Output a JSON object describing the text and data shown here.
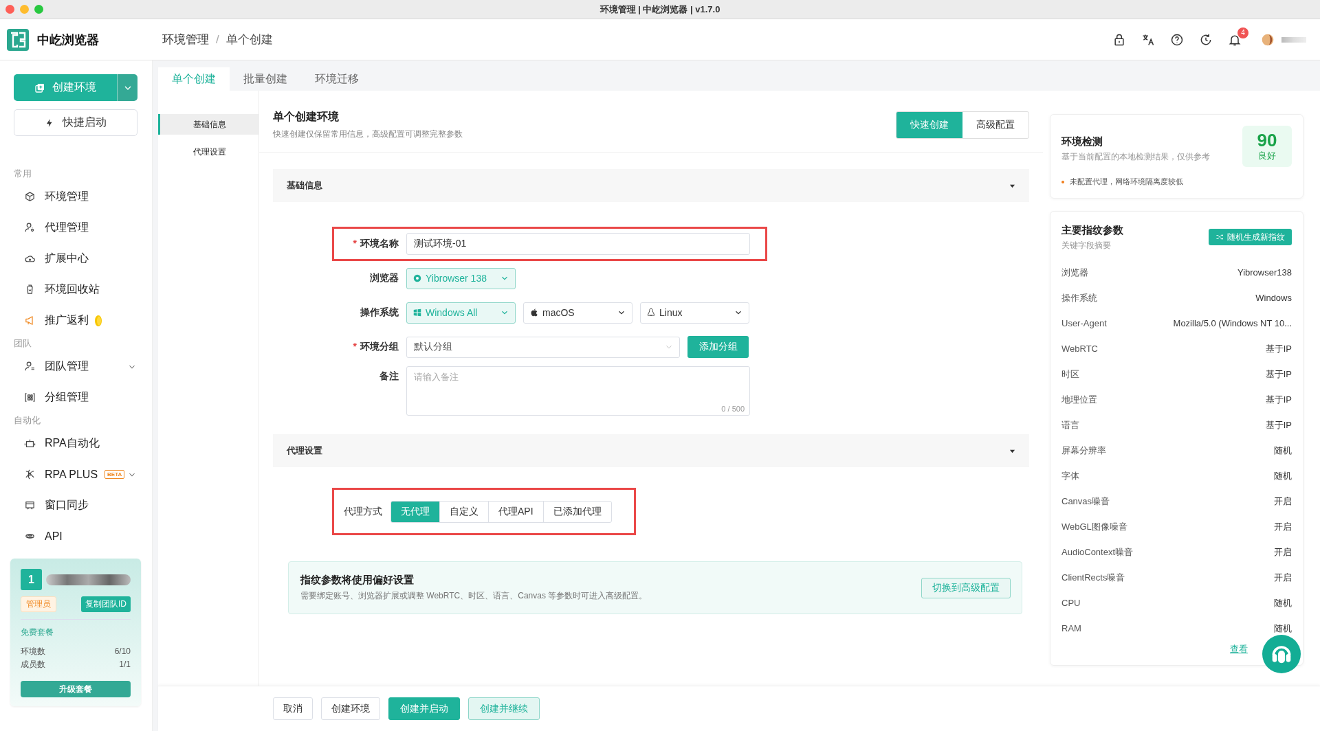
{
  "window": {
    "title": "环境管理 | 中屹浏览器 | v1.7.0"
  },
  "app": {
    "name": "中屹浏览器"
  },
  "breadcrumb": [
    "环境管理",
    "单个创建"
  ],
  "breadcrumb_separator": "/",
  "header": {
    "notification_count": "4"
  },
  "sidebar": {
    "create_button": "创建环境",
    "quick_start_button": "快捷启动",
    "sections": [
      {
        "title": "常用",
        "items": [
          {
            "label": "环境管理",
            "kind": "link"
          },
          {
            "label": "代理管理",
            "kind": "link"
          },
          {
            "label": "扩展中心",
            "kind": "link"
          },
          {
            "label": "环境回收站",
            "kind": "link"
          },
          {
            "label": "推广返利",
            "kind": "promo"
          }
        ]
      },
      {
        "title": "团队",
        "items": [
          {
            "label": "团队管理",
            "kind": "group",
            "expanded": false
          },
          {
            "label": "分组管理",
            "kind": "link"
          }
        ]
      },
      {
        "title": "自动化",
        "items": [
          {
            "label": "RPA自动化",
            "kind": "link"
          },
          {
            "label": "RPA PLUS",
            "kind": "group",
            "expanded": false,
            "badge": "BETA"
          },
          {
            "label": "窗口同步",
            "kind": "link"
          },
          {
            "label": "API",
            "kind": "link"
          }
        ]
      }
    ]
  },
  "team_card": {
    "number": "1",
    "role": "管理员",
    "copy_button": "复制团队ID",
    "plan": "免费套餐",
    "stats": [
      {
        "label": "环境数",
        "value": "6/10"
      },
      {
        "label": "成员数",
        "value": "1/1"
      }
    ],
    "upgrade_button": "升级套餐"
  },
  "tabs": [
    {
      "label": "单个创建",
      "selected": true
    },
    {
      "label": "批量创建",
      "selected": false
    },
    {
      "label": "环境迁移",
      "selected": false
    }
  ],
  "side_nav": [
    {
      "label": "基础信息",
      "selected": true
    },
    {
      "label": "代理设置",
      "selected": false
    }
  ],
  "page_header": {
    "title": "单个创建环境",
    "subtitle": "快速创建仅保留常用信息，高级配置可调整完整参数",
    "modes": [
      {
        "label": "快速创建",
        "selected": true
      },
      {
        "label": "高级配置",
        "selected": false
      }
    ]
  },
  "basic_info": {
    "title": "基础信息",
    "expanded": true,
    "name": {
      "label": "环境名称",
      "required_mark": "*",
      "highlighted": true,
      "value": "测试环境-01"
    },
    "browser": {
      "label": "浏览器",
      "options": [
        {
          "label": "Yibrowser 138",
          "selected": true
        }
      ]
    },
    "os": {
      "label": "操作系统",
      "options": [
        {
          "label": "Windows All",
          "selected": true
        },
        {
          "label": "macOS",
          "selected": false
        },
        {
          "label": "Linux",
          "selected": false
        }
      ]
    },
    "group": {
      "label": "环境分组",
      "required_mark": "*",
      "value": "默认分组",
      "button": "添加分组"
    },
    "notes": {
      "label": "备注",
      "placeholder": "请输入备注",
      "counter": "0 / 500"
    }
  },
  "proxy": {
    "title": "代理设置",
    "expanded": true,
    "label": "代理方式",
    "highlighted": true,
    "options": [
      {
        "label": "无代理",
        "selected": true
      },
      {
        "label": "自定义",
        "selected": false
      },
      {
        "label": "代理API",
        "selected": false
      },
      {
        "label": "已添加代理",
        "selected": false
      }
    ]
  },
  "notice": {
    "title": "指纹参数将使用偏好设置",
    "text": "需要绑定账号、浏览器扩展或调整 WebRTC、时区、语言、Canvas 等参数时可进入高级配置。",
    "button": "切换到高级配置"
  },
  "footer_buttons": [
    {
      "label": "取消",
      "kind": "default"
    },
    {
      "label": "创建环境",
      "kind": "default"
    },
    {
      "label": "创建并启动",
      "kind": "primary"
    },
    {
      "label": "创建并继续",
      "kind": "light"
    }
  ],
  "detection": {
    "title": "环境检测",
    "subtitle": "基于当前配置的本地检测结果，仅供参考",
    "score": "90",
    "grade": "良好",
    "warnings": [
      {
        "text": "未配置代理，网络环境隔离度较低",
        "color": "#f07d1a"
      }
    ]
  },
  "fingerprint": {
    "title": "主要指纹参数",
    "subtitle": "关键字段摘要",
    "button": "随机生成新指纹",
    "rows": [
      {
        "label": "浏览器",
        "value": "Yibrowser138"
      },
      {
        "label": "操作系统",
        "value": "Windows"
      },
      {
        "label": "User-Agent",
        "value": "Mozilla/5.0 (Windows NT 10..."
      },
      {
        "label": "WebRTC",
        "value": "基于IP"
      },
      {
        "label": "时区",
        "value": "基于IP"
      },
      {
        "label": "地理位置",
        "value": "基于IP"
      },
      {
        "label": "语言",
        "value": "基于IP"
      },
      {
        "label": "屏幕分辨率",
        "value": "随机"
      },
      {
        "label": "字体",
        "value": "随机"
      },
      {
        "label": "Canvas噪音",
        "value": "开启"
      },
      {
        "label": "WebGL图像噪音",
        "value": "开启"
      },
      {
        "label": "AudioContext噪音",
        "value": "开启"
      },
      {
        "label": "ClientRects噪音",
        "value": "开启"
      },
      {
        "label": "CPU",
        "value": "随机"
      },
      {
        "label": "RAM",
        "value": "随机"
      }
    ],
    "link": "查看"
  }
}
